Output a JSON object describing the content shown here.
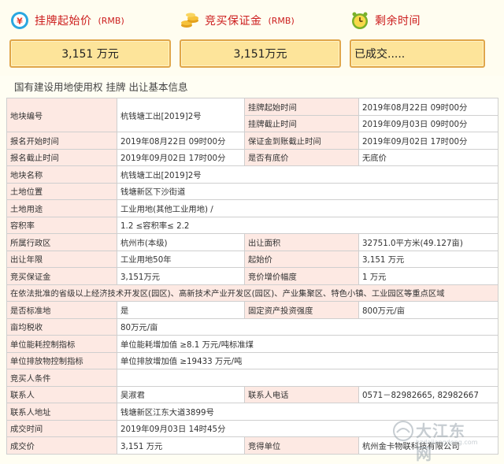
{
  "cards": [
    {
      "title": "挂牌起始价",
      "unit": "(RMB)",
      "value": "3,151  万元",
      "icon": "price-icon"
    },
    {
      "title": "竞买保证金",
      "unit": "(RMB)",
      "value": "3,151万元",
      "icon": "coins-icon"
    },
    {
      "title": "剩余时间",
      "unit": "",
      "value": "已成交.....",
      "icon": "clock-icon"
    }
  ],
  "heading": "国有建设用地使用权 挂牌 出让基本信息",
  "table": {
    "row_parcel": {
      "l1": "地块编号",
      "v1": "杭钱塘工出[2019]2号"
    },
    "row_start": {
      "l": "挂牌起始时间",
      "v": "2019年08月22日 09时00分"
    },
    "row_end": {
      "l": "挂牌截止时间",
      "v": "2019年09月03日 09时00分"
    },
    "row_reg_start": {
      "l1": "报名开始时间",
      "v1": "2019年08月22日 09时00分",
      "l2": "保证金到账截止时间",
      "v2": "2019年09月02日 17时00分"
    },
    "row_reg_end": {
      "l1": "报名截止时间",
      "v1": "2019年09月02日 17时00分",
      "l2": "是否有底价",
      "v2": "无底价"
    },
    "row_name": {
      "l": "地块名称",
      "v": "杭钱塘工出[2019]2号"
    },
    "row_loc": {
      "l": "土地位置",
      "v": "钱塘新区下沙街道"
    },
    "row_use": {
      "l": "土地用途",
      "v": "工业用地(其他工业用地) /"
    },
    "row_far": {
      "l": "容积率",
      "v": "1.2 ≤容积率≤ 2.2"
    },
    "row_admin": {
      "l1": "所属行政区",
      "v1": "杭州市(本级)",
      "l2": "出让面积",
      "v2": "32751.0平方米(49.127亩)"
    },
    "row_years": {
      "l1": "出让年限",
      "v1": "工业用地50年",
      "l2": "起始价",
      "v2": "3,151  万元"
    },
    "row_deposit": {
      "l1": "竞买保证金",
      "v1": "3,151万元",
      "l2": "竞价增价幅度",
      "v2": "1  万元"
    },
    "row_note": "在依法批准的省级以上经济技术开发区(园区)、高新技术产业开发区(园区)、产业集聚区、特色小镇、工业园区等重点区域",
    "row_std": {
      "l1": "是否标准地",
      "v1": "是",
      "l2": "固定资产投资强度",
      "v2": "800万元/亩"
    },
    "row_tax": {
      "l": "亩均税收",
      "v": "80万元/亩"
    },
    "row_energy": {
      "l": "单位能耗控制指标",
      "v": "单位能耗增加值 ≥8.1 万元/吨标准煤"
    },
    "row_emit": {
      "l": "单位排放物控制指标",
      "v": "单位排放增加值 ≥19433 万元/吨"
    },
    "row_cond": {
      "l": "竞买人条件",
      "v": ""
    },
    "row_contact": {
      "l1": "联系人",
      "v1": "吴淑君",
      "l2": "联系人电话",
      "v2": "0571－82982665, 82982667"
    },
    "row_addr": {
      "l": "联系人地址",
      "v": "钱塘新区江东大道3899号"
    },
    "row_deal_time": {
      "l": "成交时间",
      "v": "2019年09月03日 14时45分"
    },
    "row_deal_price": {
      "l1": "成交价",
      "v1": "3,151  万元",
      "l2": "竞得单位",
      "v2": "杭州金卡物联科技有限公司"
    }
  },
  "watermark": {
    "text": "大江东网",
    "sub": "hzdajiangdong.com"
  }
}
